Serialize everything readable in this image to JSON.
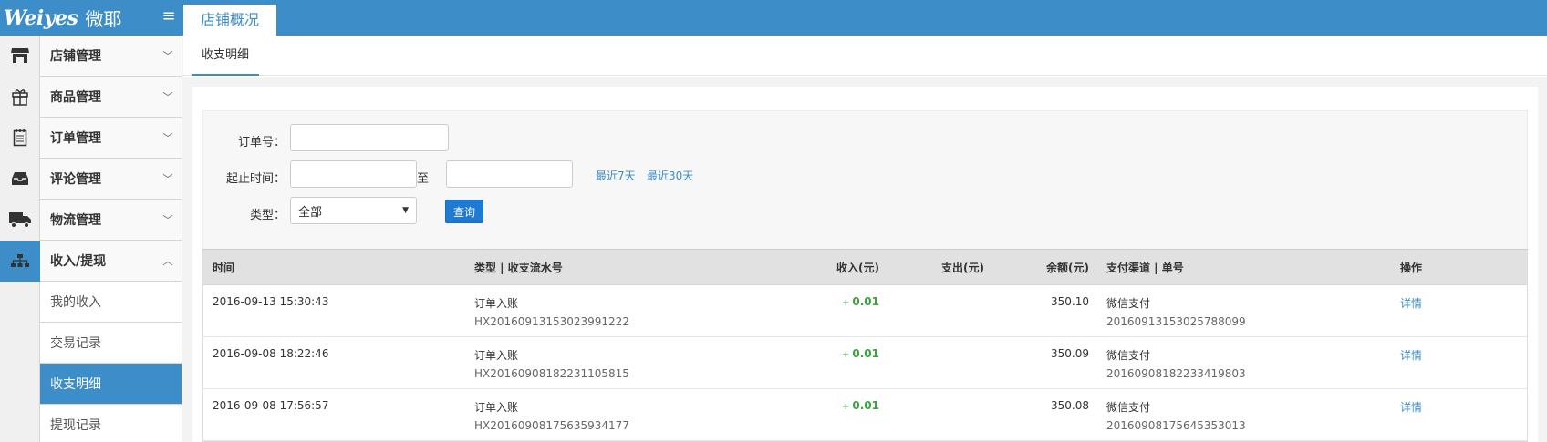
{
  "header": {
    "logo_text": "Weiyes",
    "logo_cn": "微耶",
    "menu_icon": "≡",
    "active_tab": "店铺概况"
  },
  "sidebar": {
    "items": [
      {
        "label": "店铺管理",
        "icon": "store-icon"
      },
      {
        "label": "商品管理",
        "icon": "gift-icon"
      },
      {
        "label": "订单管理",
        "icon": "notepad-icon"
      },
      {
        "label": "评论管理",
        "icon": "inbox-icon"
      },
      {
        "label": "物流管理",
        "icon": "truck-icon"
      },
      {
        "label": "收入/提现",
        "icon": "sitemap-icon"
      }
    ],
    "subitems": [
      {
        "label": "我的收入"
      },
      {
        "label": "交易记录"
      },
      {
        "label": "收支明细"
      },
      {
        "label": "提现记录"
      }
    ]
  },
  "subtabs": {
    "active": "收支明细"
  },
  "filter": {
    "order_label": "订单号：",
    "order_value": "",
    "date_label": "起止时间：",
    "date_sep": "至",
    "date_from": "",
    "date_to": "",
    "last7": "最近7天",
    "last30": "最近30天",
    "type_label": "类型：",
    "type_value": "全部",
    "query_button": "查询"
  },
  "table": {
    "headers": {
      "time": "时间",
      "type": "类型 | 收支流水号",
      "income": "收入(元)",
      "expense": "支出(元)",
      "balance": "余额(元)",
      "channel": "支付渠道 | 单号",
      "op": "操作"
    },
    "rows": [
      {
        "time": "2016-09-13 15:30:43",
        "type": "订单入账",
        "serial": "HX20160913153023991222",
        "income_sign": "+",
        "income": "0.01",
        "expense": "",
        "balance": "350.10",
        "channel": "微信支付",
        "order_no": "20160913153025788099",
        "op": "详情"
      },
      {
        "time": "2016-09-08 18:22:46",
        "type": "订单入账",
        "serial": "HX20160908182231105815",
        "income_sign": "+",
        "income": "0.01",
        "expense": "",
        "balance": "350.09",
        "channel": "微信支付",
        "order_no": "20160908182233419803",
        "op": "详情"
      },
      {
        "time": "2016-09-08 17:56:57",
        "type": "订单入账",
        "serial": "HX20160908175635934177",
        "income_sign": "+",
        "income": "0.01",
        "expense": "",
        "balance": "350.08",
        "channel": "微信支付",
        "order_no": "20160908175645353013",
        "op": "详情"
      }
    ]
  },
  "colors": {
    "accent": "#3c8dc8",
    "income_green": "#3aa33a",
    "button_blue": "#1f7ad2"
  }
}
